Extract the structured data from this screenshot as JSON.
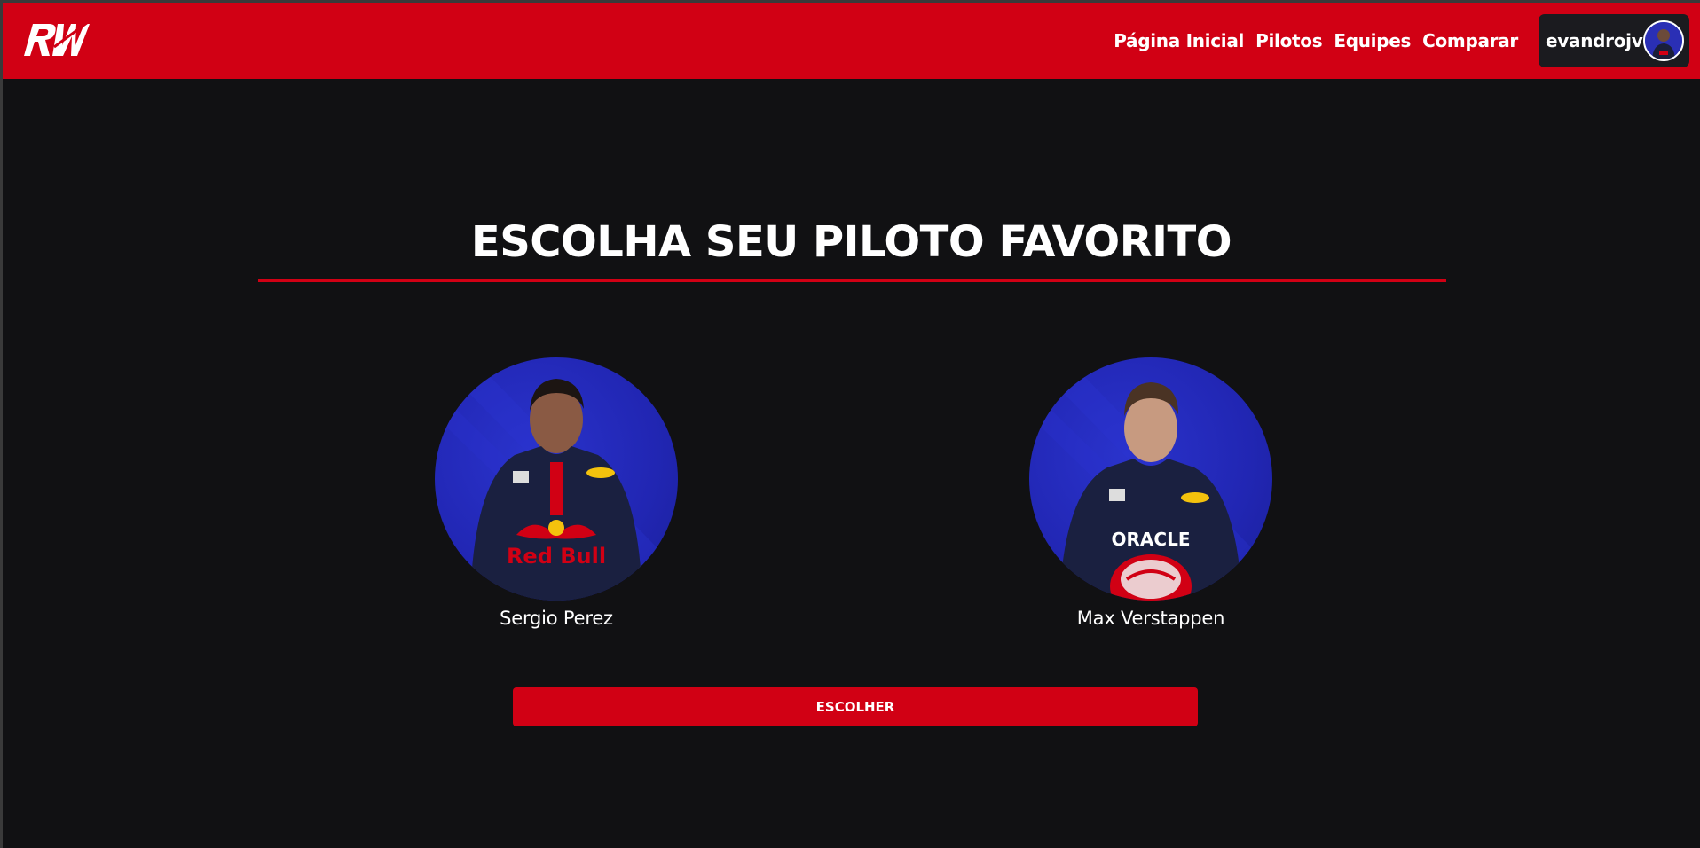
{
  "header": {
    "logo_text": "RW",
    "nav": [
      {
        "label": "Página Inicial"
      },
      {
        "label": "Pilotos"
      },
      {
        "label": "Equipes"
      },
      {
        "label": "Comparar"
      }
    ],
    "user": {
      "name": "evandrojv"
    }
  },
  "main": {
    "title": "ESCOLHA SEU PILOTO FAVORITO",
    "drivers": [
      {
        "name": "Sergio Perez"
      },
      {
        "name": "Max Verstappen"
      }
    ],
    "choose_label": "ESCOLHER"
  },
  "colors": {
    "brand_red": "#d10014",
    "background": "#111113",
    "driver_backdrop": "#2126b3"
  },
  "icons": {
    "logo": "rw-logo",
    "avatar": "user-avatar"
  }
}
